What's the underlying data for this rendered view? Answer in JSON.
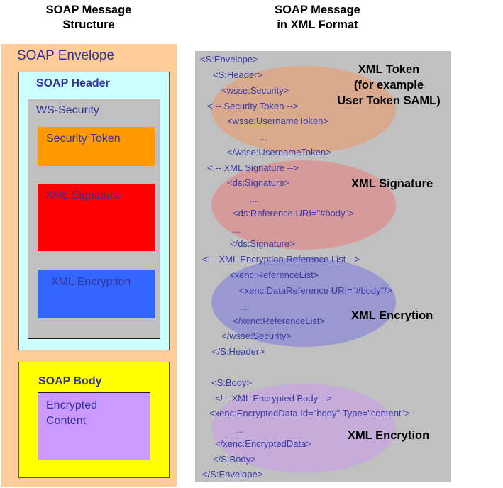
{
  "left_title": [
    "SOAP Message",
    "Structure"
  ],
  "right_title": [
    "SOAP Message",
    "in XML Format"
  ],
  "structure": {
    "envelope": {
      "label": "SOAP Envelope",
      "color": "#ffcc99"
    },
    "header": {
      "label": "SOAP Header",
      "color": "#ccffff"
    },
    "ws_security": {
      "label": "WS-Security",
      "color": "#c0c0c0"
    },
    "security_token": {
      "label": "Security Token",
      "color": "#ff9900"
    },
    "xml_signature": {
      "label": "XML Signature",
      "color": "#ff0000"
    },
    "xml_encryption": {
      "label": "XML Encryption",
      "color": "#3366ff"
    },
    "body": {
      "label": "SOAP Body",
      "color": "#ffff00"
    },
    "encrypted_content": {
      "label_lines": [
        "Encrypted",
        "Content"
      ],
      "color": "#cc99ff"
    }
  },
  "xml_lines": [
    "<S:Envelope>",
    "<S:Header>",
    "<wsse:Security>",
    "<!-- Security Token -->",
    "<wsse:UsernameToken>",
    "...",
    "</wsse:UsernameToken>",
    "<!-- XML Signature -->",
    "<ds:Signature>",
    "...",
    "<ds:Reference URI=\"#body\">",
    "...",
    "</ds:Signature>",
    "<!-- XML Encryption Reference List -->",
    "<xenc:ReferenceList>",
    "<xenc:DataReference URI=\"#body\"/>",
    "...",
    "</xenc:ReferenceList>",
    "</wsse:Security>",
    "</S:Header>",
    "<S:Body>",
    "<!-- XML Encrypted Body -->",
    "<xenc:EncryptedData Id=\"body\" Type=\"content\">",
    "...",
    "</xenc:EncryptedData>",
    "</S:Body>",
    "</S:Envelope>"
  ],
  "annotations": {
    "token": [
      "XML Token",
      "(for example",
      "User Token SAML)"
    ],
    "signature": "XML Signature",
    "encryption_header": "XML Encrytion",
    "encryption_body": "XML Encrytion"
  },
  "highlight_colors": {
    "token": "#ffaa77",
    "signature": "#ff7777",
    "encryption_header": "#7777ff",
    "encryption_body": "#cc99ff"
  }
}
